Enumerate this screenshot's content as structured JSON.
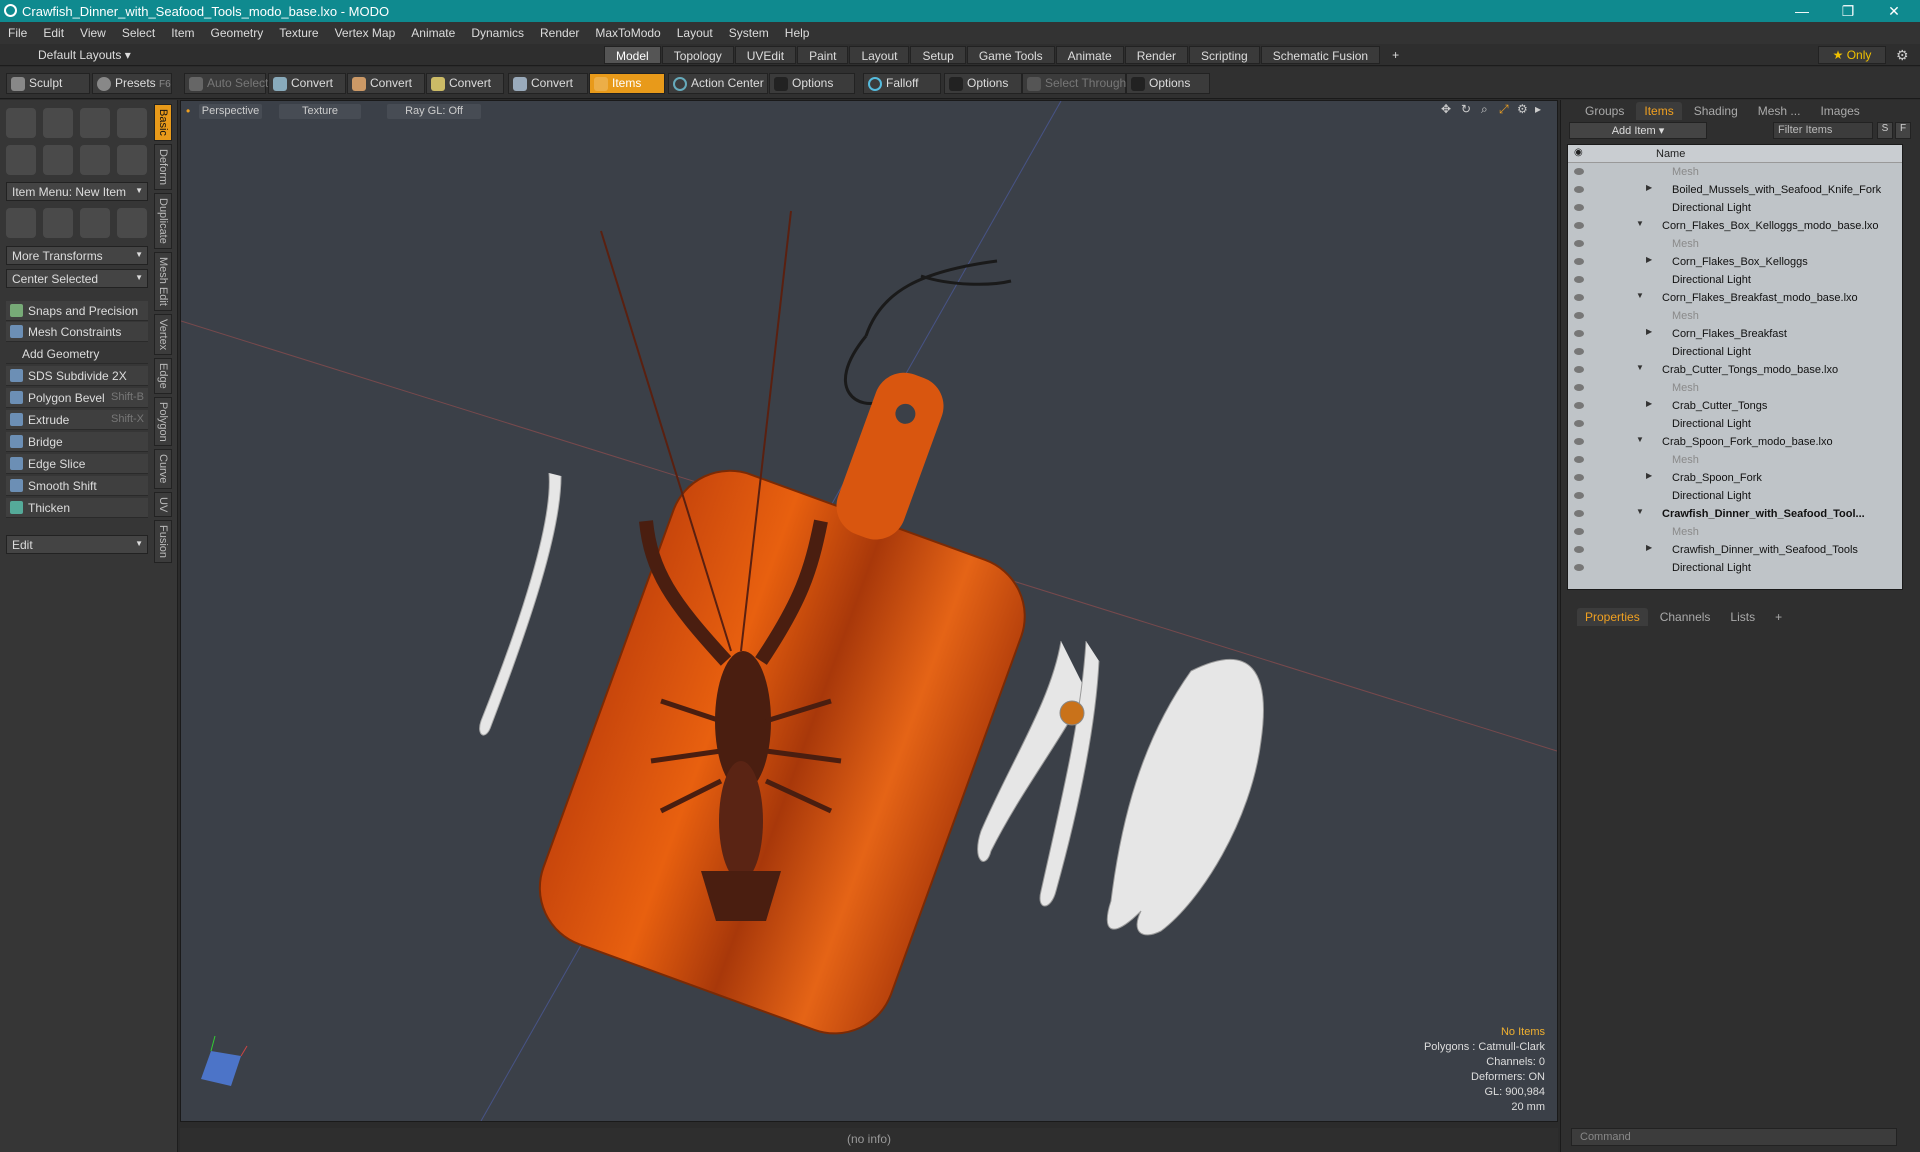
{
  "titlebar": {
    "title": "Crawfish_Dinner_with_Seafood_Tools_modo_base.lxo - MODO",
    "minimize": "—",
    "maximize": "❐",
    "close": "✕"
  },
  "menu": [
    "File",
    "Edit",
    "View",
    "Select",
    "Item",
    "Geometry",
    "Texture",
    "Vertex Map",
    "Animate",
    "Dynamics",
    "Render",
    "MaxToModo",
    "Layout",
    "System",
    "Help"
  ],
  "layoutbar": {
    "default_layouts": "Default Layouts ▾",
    "tabs": [
      "Model",
      "Topology",
      "UVEdit",
      "Paint",
      "Layout",
      "Setup",
      "Game Tools",
      "Animate",
      "Render",
      "Scripting",
      "Schematic Fusion"
    ],
    "active_tab": "Model",
    "plus": "+",
    "only": "★ Only"
  },
  "toolbar": {
    "sculpt": "Sculpt",
    "presets": "Presets",
    "presets_key": "F6",
    "auto_select": "Auto Select",
    "convert1": "Convert",
    "convert2": "Convert",
    "convert3": "Convert",
    "convert4": "Convert",
    "items": "Items",
    "action_center": "Action Center",
    "options1": "Options",
    "falloff": "Falloff",
    "options2": "Options",
    "select_through": "Select Through",
    "options3": "Options"
  },
  "leftpanel": {
    "item_menu": "Item Menu: New Item",
    "more_transforms": "More Transforms",
    "center_selected": "Center Selected",
    "snaps": "Snaps and Precision",
    "mesh_constraints": "Mesh Constraints",
    "add_geometry": "Add Geometry",
    "tools": [
      {
        "label": "SDS Subdivide 2X",
        "shortcut": ""
      },
      {
        "label": "Polygon Bevel",
        "shortcut": "Shift-B"
      },
      {
        "label": "Extrude",
        "shortcut": "Shift-X"
      },
      {
        "label": "Bridge",
        "shortcut": ""
      },
      {
        "label": "Edge Slice",
        "shortcut": ""
      },
      {
        "label": "Smooth Shift",
        "shortcut": ""
      },
      {
        "label": "Thicken",
        "shortcut": ""
      }
    ],
    "edit": "Edit",
    "vtabs": [
      "Basic",
      "Deform",
      "Duplicate",
      "Mesh Edit",
      "Vertex",
      "Edge",
      "Polygon",
      "Curve",
      "UV",
      "Fusion"
    ]
  },
  "viewport": {
    "perspective": "Perspective",
    "texture": "Texture",
    "raygl": "Ray GL: Off",
    "stats": {
      "no_items": "No Items",
      "polygons": "Polygons : Catmull-Clark",
      "channels": "Channels: 0",
      "deformers": "Deformers: ON",
      "gl": "GL: 900,984",
      "scale": "20 mm"
    }
  },
  "statusbar": "(no info)",
  "rightpanel": {
    "tabs_top": [
      "Groups",
      "Items",
      "Shading",
      "Mesh ...",
      "Images"
    ],
    "active_top": "Items",
    "add_item": "Add Item",
    "filter_items": "Filter Items",
    "s": "S",
    "f": "F",
    "name_col": "Name",
    "rows": [
      {
        "name": "Mesh",
        "indent": 92,
        "type": "dim"
      },
      {
        "name": "Boiled_Mussels_with_Seafood_Knife_Fork",
        "indent": 92,
        "type": "item",
        "tri": "▶"
      },
      {
        "name": "Directional Light",
        "indent": 92,
        "type": "item"
      },
      {
        "name": "Corn_Flakes_Box_Kelloggs_modo_base.lxo",
        "indent": 82,
        "type": "scene",
        "tri": "▼"
      },
      {
        "name": "Mesh",
        "indent": 92,
        "type": "dim"
      },
      {
        "name": "Corn_Flakes_Box_Kelloggs",
        "indent": 92,
        "type": "item",
        "tri": "▶"
      },
      {
        "name": "Directional Light",
        "indent": 92,
        "type": "item"
      },
      {
        "name": "Corn_Flakes_Breakfast_modo_base.lxo",
        "indent": 82,
        "type": "scene",
        "tri": "▼"
      },
      {
        "name": "Mesh",
        "indent": 92,
        "type": "dim"
      },
      {
        "name": "Corn_Flakes_Breakfast",
        "indent": 92,
        "type": "item",
        "tri": "▶"
      },
      {
        "name": "Directional Light",
        "indent": 92,
        "type": "item"
      },
      {
        "name": "Crab_Cutter_Tongs_modo_base.lxo",
        "indent": 82,
        "type": "scene",
        "tri": "▼"
      },
      {
        "name": "Mesh",
        "indent": 92,
        "type": "dim"
      },
      {
        "name": "Crab_Cutter_Tongs",
        "indent": 92,
        "type": "item",
        "tri": "▶"
      },
      {
        "name": "Directional Light",
        "indent": 92,
        "type": "item"
      },
      {
        "name": "Crab_Spoon_Fork_modo_base.lxo",
        "indent": 82,
        "type": "scene",
        "tri": "▼"
      },
      {
        "name": "Mesh",
        "indent": 92,
        "type": "dim"
      },
      {
        "name": "Crab_Spoon_Fork",
        "indent": 92,
        "type": "item",
        "tri": "▶"
      },
      {
        "name": "Directional Light",
        "indent": 92,
        "type": "item"
      },
      {
        "name": "Crawfish_Dinner_with_Seafood_Tool...",
        "indent": 82,
        "type": "bold",
        "tri": "▼"
      },
      {
        "name": "Mesh",
        "indent": 92,
        "type": "dim"
      },
      {
        "name": "Crawfish_Dinner_with_Seafood_Tools",
        "indent": 92,
        "type": "item",
        "tri": "▶"
      },
      {
        "name": "Directional Light",
        "indent": 92,
        "type": "item"
      }
    ],
    "tabs_bottom": [
      "Properties",
      "Channels",
      "Lists",
      "+"
    ],
    "active_bottom": "Properties",
    "command": "Command"
  }
}
